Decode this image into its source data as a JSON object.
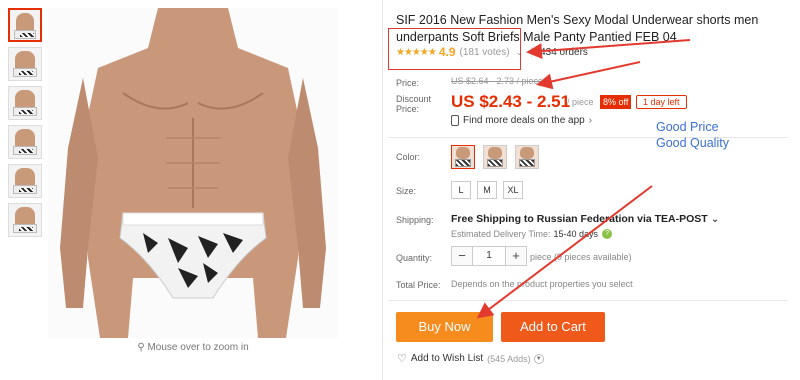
{
  "product": {
    "title": "SIF 2016 New Fashion Men's Sexy Modal Underwear shorts men underpants Soft Briefs Male Panty Pantied FEB 04",
    "stars": "★★★★★",
    "rating": "4.9",
    "votes": "(181 votes)",
    "orders": "434 orders"
  },
  "gallery": {
    "zoom_hint": "Mouse over to zoom in",
    "thumbnail_count": 6
  },
  "price": {
    "label": "Price:",
    "original": "US $2.64 - 2.73 / piece",
    "discount_label": "Discount Price:",
    "discount": "US $2.43 - 2.51",
    "per_piece": "/ piece",
    "off_badge": "8% off",
    "time_left": "1 day left",
    "deals": "Find more deals on the app"
  },
  "annotations": {
    "good_price": "Good Price",
    "good_quality": "Good Quality"
  },
  "options": {
    "color_label": "Color:",
    "size_label": "Size:",
    "sizes": [
      "L",
      "M",
      "XL"
    ]
  },
  "shipping": {
    "label": "Shipping:",
    "text": "Free Shipping to Russian Federation via TEA-POST",
    "delivery_label": "Estimated Delivery Time:",
    "delivery_days": "15-40 days"
  },
  "quantity": {
    "label": "Quantity:",
    "value": "1",
    "minus": "−",
    "plus": "+",
    "available": "piece (9 pieces available)"
  },
  "total": {
    "label": "Total Price:",
    "text": "Depends on the product properties you select"
  },
  "actions": {
    "buy_now": "Buy Now",
    "add_to_cart": "Add to Cart",
    "wish": "Add to Wish List",
    "wish_count": "(545 Adds)"
  },
  "colors": {
    "price_red": "#e62e04",
    "buy_orange": "#f68b1e",
    "cart_orange": "#ef5a1b",
    "annotation_blue": "#3b6fd6",
    "arrow_red": "#e23a2e",
    "star_gold": "#f5a623"
  }
}
